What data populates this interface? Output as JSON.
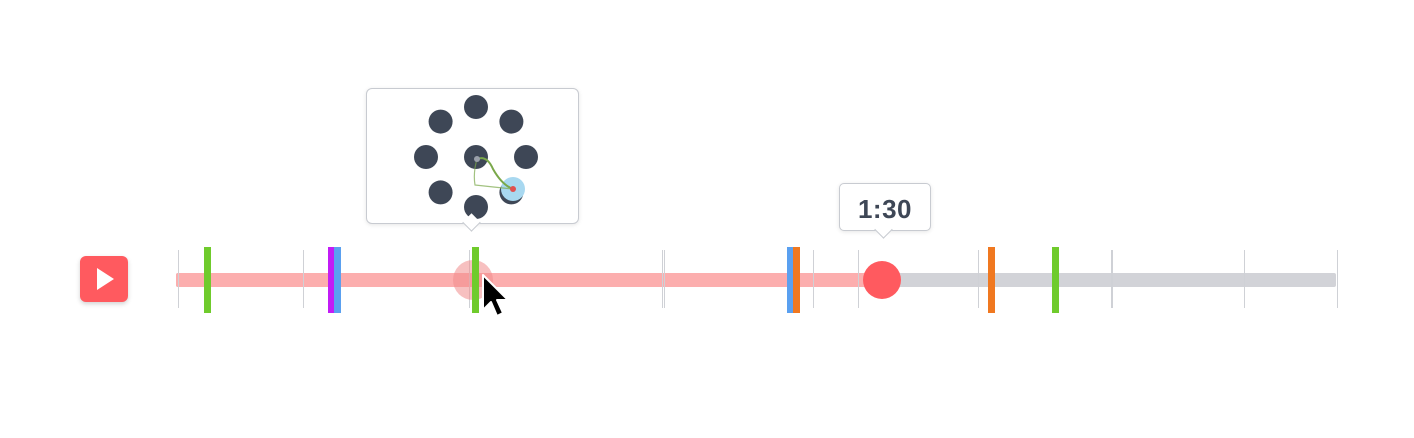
{
  "player": {
    "play_button": {
      "icon": "play-icon",
      "color": "#ff5a5f"
    },
    "current_time_label": "1:30",
    "progress_fraction": 0.608,
    "hover_fraction": 0.255,
    "colors": {
      "progress": "#fcaeae",
      "remaining": "#d2d3d8",
      "playhead": "#ff5a5f",
      "hover": "#f08c8c"
    },
    "ticks": [
      0.0,
      0.108,
      0.251,
      0.418,
      0.419,
      0.548,
      0.587,
      0.69,
      0.806,
      0.805,
      0.92,
      1.0
    ],
    "event_markers": [
      {
        "fraction": 0.024,
        "color": "#6fcb2c"
      },
      {
        "fraction": 0.131,
        "color": "#c21cf5"
      },
      {
        "fraction": 0.136,
        "color": "#5aa0f0"
      },
      {
        "fraction": 0.255,
        "color": "#6fcb2c"
      },
      {
        "fraction": 0.527,
        "color": "#5aa0f0"
      },
      {
        "fraction": 0.532,
        "color": "#f07820"
      },
      {
        "fraction": 0.7,
        "color": "#f07820"
      },
      {
        "fraction": 0.755,
        "color": "#6fcb2c"
      }
    ]
  },
  "preview": {
    "dot_color": "#3e4756",
    "path_color": "#7aa84a",
    "highlight_color": "#a8d8f0",
    "end_point_color": "#e05050",
    "start_point_color": "#9aa0aa"
  },
  "cursor": {
    "icon": "mouse-pointer-icon"
  }
}
